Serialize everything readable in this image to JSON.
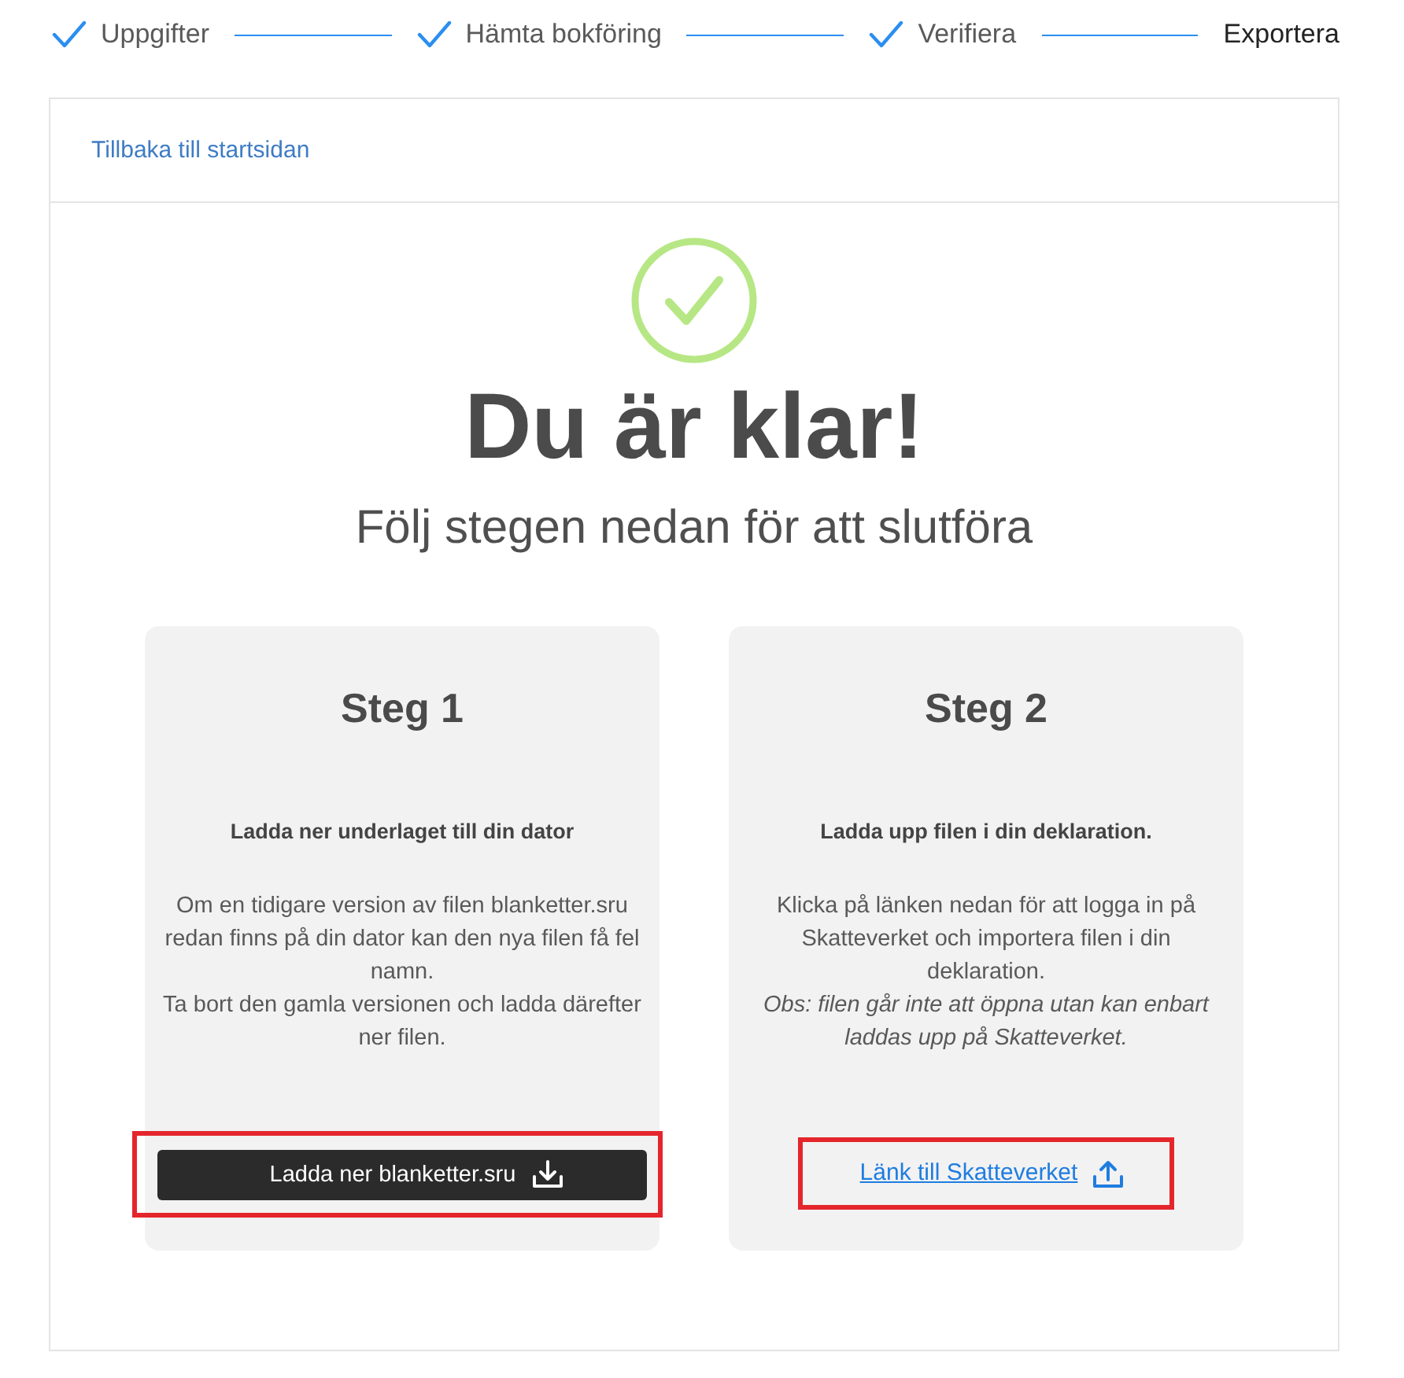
{
  "stepper": {
    "steps": [
      {
        "label": "Uppgifter",
        "completed": true
      },
      {
        "label": "Hämta bokföring",
        "completed": true
      },
      {
        "label": "Verifiera",
        "completed": true
      },
      {
        "label": "Exportera",
        "completed": false
      }
    ]
  },
  "panel": {
    "back_link": "Tillbaka till startsidan",
    "heading": "Du är klar!",
    "subheading": "Följ stegen nedan för att slutföra"
  },
  "step_cards": [
    {
      "title": "Steg 1",
      "lead": "Ladda ner underlaget till din dator",
      "paragraphs": [
        {
          "kind": "text",
          "text": "Om en tidigare version av filen blanketter.sru redan finns på din dator kan den nya filen få fel namn."
        },
        {
          "kind": "text",
          "text": "Ta bort den gamla versionen och ladda därefter ner filen."
        }
      ],
      "action": {
        "kind": "button",
        "label": "Ladda ner blanketter.sru",
        "highlighted": true
      }
    },
    {
      "title": "Steg 2",
      "lead": "Ladda upp filen i din deklaration.",
      "paragraphs": [
        {
          "kind": "text",
          "text": "Klicka på länken nedan för att logga in på Skatteverket och importera filen i din deklaration."
        },
        {
          "kind": "note",
          "text": "Obs: filen går inte att öppna utan kan enbart laddas upp på Skatteverket."
        }
      ],
      "action": {
        "kind": "link",
        "label": "Länk till Skatteverket",
        "highlighted": true
      }
    }
  ]
}
